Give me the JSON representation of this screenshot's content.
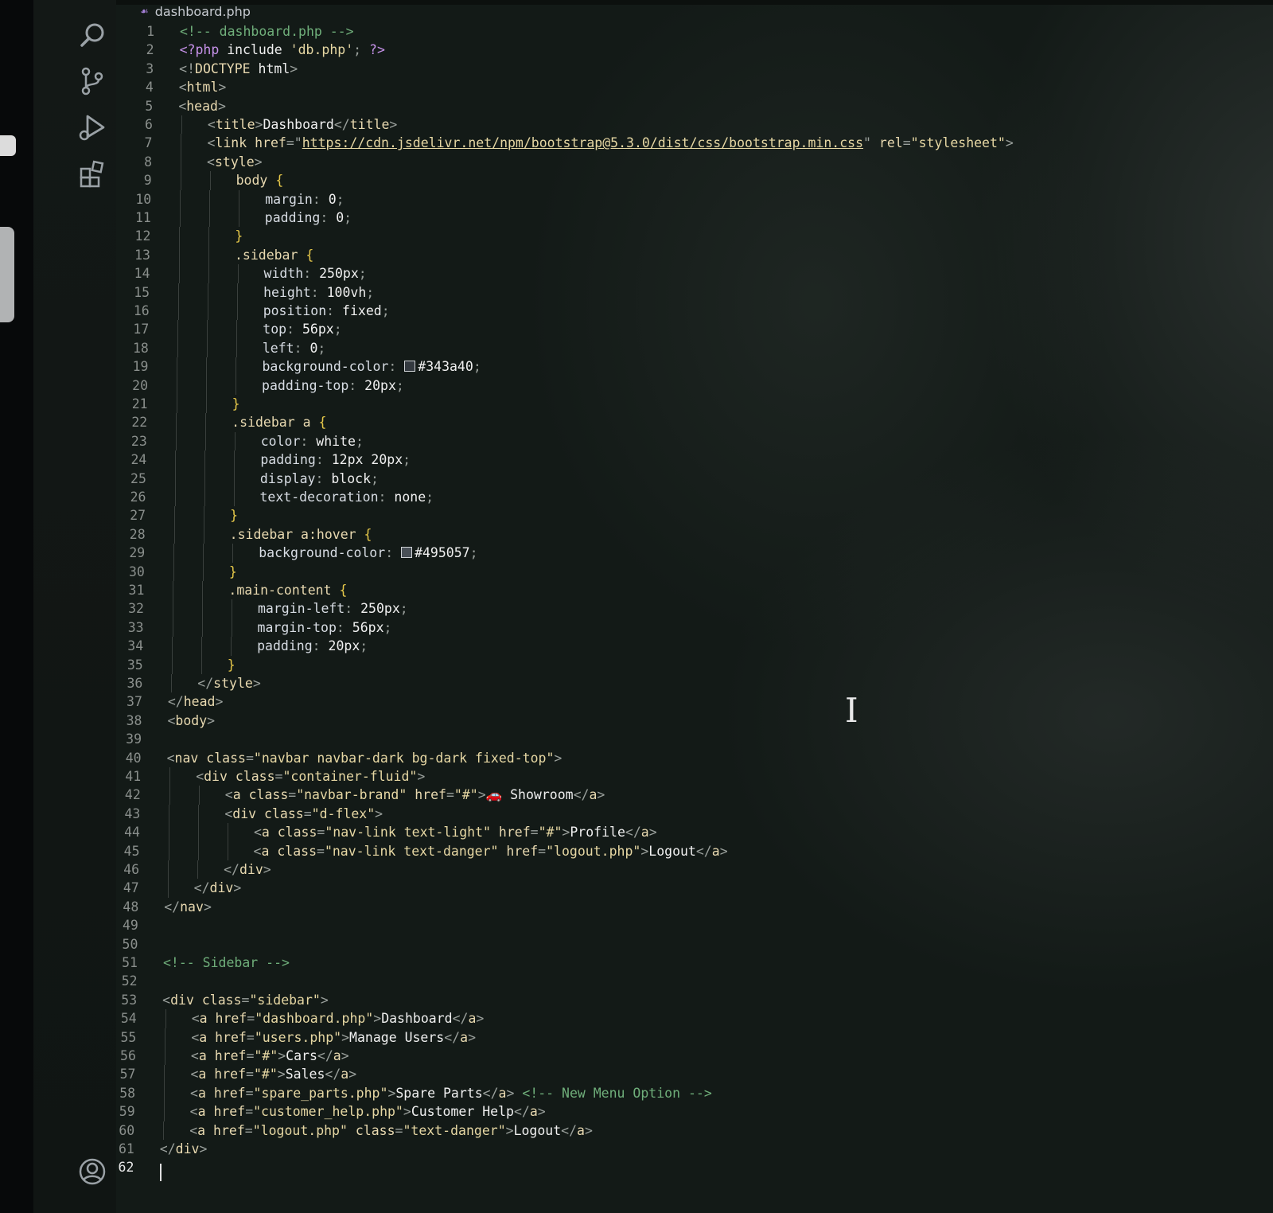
{
  "tab": {
    "filename": "dashboard.php"
  },
  "activity_bar": {
    "icons": [
      "search-icon",
      "source-control-icon",
      "run-debug-icon",
      "extensions-icon",
      "account-icon"
    ]
  },
  "editor": {
    "current_line": 62,
    "lines": [
      {
        "n": 1,
        "ind": 0,
        "html": "<span class='t-com'>&lt;!-- dashboard.php --&gt;</span>"
      },
      {
        "n": 2,
        "ind": 0,
        "html": "<span class='t-php'>&lt;?php</span> <span class='t-text'>include</span> <span class='t-str'>'db.php'</span><span class='t-punc'>;</span> <span class='t-php'>?&gt;</span>"
      },
      {
        "n": 3,
        "ind": 0,
        "html": "<span class='t-punc'>&lt;!</span><span class='t-tag'>DOCTYPE</span> <span class='t-text'>html</span><span class='t-punc'>&gt;</span>"
      },
      {
        "n": 4,
        "ind": 0,
        "html": "<span class='t-punc'>&lt;</span><span class='t-tag'>html</span><span class='t-punc'>&gt;</span>"
      },
      {
        "n": 5,
        "ind": 0,
        "html": "<span class='t-punc'>&lt;</span><span class='t-tag'>head</span><span class='t-punc'>&gt;</span>"
      },
      {
        "n": 6,
        "ind": 1,
        "html": "<span class='t-punc'>&lt;</span><span class='t-tag'>title</span><span class='t-punc'>&gt;</span><span class='t-text'>Dashboard</span><span class='t-punc'>&lt;/</span><span class='t-tag'>title</span><span class='t-punc'>&gt;</span>"
      },
      {
        "n": 7,
        "ind": 1,
        "html": "<span class='t-punc'>&lt;</span><span class='t-tag'>link</span> <span class='t-attr'>href</span><span class='t-punc'>=\"</span><span class='t-url'>https://cdn.jsdelivr.net/npm/bootstrap@5.3.0/dist/css/bootstrap.min.css</span><span class='t-punc'>\"</span> <span class='t-attr'>rel</span><span class='t-punc'>=</span><span class='t-str'>\"stylesheet\"</span><span class='t-punc'>&gt;</span>"
      },
      {
        "n": 8,
        "ind": 1,
        "html": "<span class='t-punc'>&lt;</span><span class='t-tag'>style</span><span class='t-punc'>&gt;</span>"
      },
      {
        "n": 9,
        "ind": 2,
        "html": "<span class='t-sel'>body</span> <span class='t-brace'>{</span>"
      },
      {
        "n": 10,
        "ind": 3,
        "html": "<span class='t-prop'>margin</span><span class='t-punc'>:</span> <span class='t-val'>0</span><span class='t-punc'>;</span>"
      },
      {
        "n": 11,
        "ind": 3,
        "html": "<span class='t-prop'>padding</span><span class='t-punc'>:</span> <span class='t-val'>0</span><span class='t-punc'>;</span>"
      },
      {
        "n": 12,
        "ind": 2,
        "html": "<span class='t-brace'>}</span>"
      },
      {
        "n": 13,
        "ind": 2,
        "html": "<span class='t-sel'>.sidebar</span> <span class='t-brace'>{</span>"
      },
      {
        "n": 14,
        "ind": 3,
        "html": "<span class='t-prop'>width</span><span class='t-punc'>:</span> <span class='t-val'>250px</span><span class='t-punc'>;</span>"
      },
      {
        "n": 15,
        "ind": 3,
        "html": "<span class='t-prop'>height</span><span class='t-punc'>:</span> <span class='t-val'>100vh</span><span class='t-punc'>;</span>"
      },
      {
        "n": 16,
        "ind": 3,
        "html": "<span class='t-prop'>position</span><span class='t-punc'>:</span> <span class='t-val'>fixed</span><span class='t-punc'>;</span>"
      },
      {
        "n": 17,
        "ind": 3,
        "html": "<span class='t-prop'>top</span><span class='t-punc'>:</span> <span class='t-val'>56px</span><span class='t-punc'>;</span>"
      },
      {
        "n": 18,
        "ind": 3,
        "html": "<span class='t-prop'>left</span><span class='t-punc'>:</span> <span class='t-val'>0</span><span class='t-punc'>;</span>"
      },
      {
        "n": 19,
        "ind": 3,
        "html": "<span class='t-prop'>background-color</span><span class='t-punc'>:</span> <span class='swatch' style='background:#343a40'></span><span class='t-val'>#343a40</span><span class='t-punc'>;</span>"
      },
      {
        "n": 20,
        "ind": 3,
        "html": "<span class='t-prop'>padding-top</span><span class='t-punc'>:</span> <span class='t-val'>20px</span><span class='t-punc'>;</span>"
      },
      {
        "n": 21,
        "ind": 2,
        "html": "<span class='t-brace'>}</span>"
      },
      {
        "n": 22,
        "ind": 2,
        "html": "<span class='t-sel'>.sidebar a</span> <span class='t-brace'>{</span>"
      },
      {
        "n": 23,
        "ind": 3,
        "html": "<span class='t-prop'>color</span><span class='t-punc'>:</span> <span class='t-val'>white</span><span class='t-punc'>;</span>"
      },
      {
        "n": 24,
        "ind": 3,
        "html": "<span class='t-prop'>padding</span><span class='t-punc'>:</span> <span class='t-val'>12px 20px</span><span class='t-punc'>;</span>"
      },
      {
        "n": 25,
        "ind": 3,
        "html": "<span class='t-prop'>display</span><span class='t-punc'>:</span> <span class='t-val'>block</span><span class='t-punc'>;</span>"
      },
      {
        "n": 26,
        "ind": 3,
        "html": "<span class='t-prop'>text-decoration</span><span class='t-punc'>:</span> <span class='t-val'>none</span><span class='t-punc'>;</span>"
      },
      {
        "n": 27,
        "ind": 2,
        "html": "<span class='t-brace'>}</span>"
      },
      {
        "n": 28,
        "ind": 2,
        "html": "<span class='t-sel'>.sidebar a:hover</span> <span class='t-brace'>{</span>"
      },
      {
        "n": 29,
        "ind": 3,
        "html": "<span class='t-prop'>background-color</span><span class='t-punc'>:</span> <span class='swatch' style='background:#495057'></span><span class='t-val'>#495057</span><span class='t-punc'>;</span>"
      },
      {
        "n": 30,
        "ind": 2,
        "html": "<span class='t-brace'>}</span>"
      },
      {
        "n": 31,
        "ind": 2,
        "html": "<span class='t-sel'>.main-content</span> <span class='t-brace'>{</span>"
      },
      {
        "n": 32,
        "ind": 3,
        "html": "<span class='t-prop'>margin-left</span><span class='t-punc'>:</span> <span class='t-val'>250px</span><span class='t-punc'>;</span>"
      },
      {
        "n": 33,
        "ind": 3,
        "html": "<span class='t-prop'>margin-top</span><span class='t-punc'>:</span> <span class='t-val'>56px</span><span class='t-punc'>;</span>"
      },
      {
        "n": 34,
        "ind": 3,
        "html": "<span class='t-prop'>padding</span><span class='t-punc'>:</span> <span class='t-val'>20px</span><span class='t-punc'>;</span>"
      },
      {
        "n": 35,
        "ind": 2,
        "html": "<span class='t-brace'>}</span>"
      },
      {
        "n": 36,
        "ind": 1,
        "html": "<span class='t-punc'>&lt;/</span><span class='t-tag'>style</span><span class='t-punc'>&gt;</span>"
      },
      {
        "n": 37,
        "ind": 0,
        "html": "<span class='t-punc'>&lt;/</span><span class='t-tag'>head</span><span class='t-punc'>&gt;</span>"
      },
      {
        "n": 38,
        "ind": 0,
        "html": "<span class='t-punc'>&lt;</span><span class='t-tag'>body</span><span class='t-punc'>&gt;</span>"
      },
      {
        "n": 39,
        "ind": 0,
        "html": ""
      },
      {
        "n": 40,
        "ind": 0,
        "html": "<span class='t-punc'>&lt;</span><span class='t-tag'>nav</span> <span class='t-attr'>class</span><span class='t-punc'>=</span><span class='t-str'>\"navbar navbar-dark bg-dark fixed-top\"</span><span class='t-punc'>&gt;</span>"
      },
      {
        "n": 41,
        "ind": 1,
        "html": "<span class='t-punc'>&lt;</span><span class='t-tag'>div</span> <span class='t-attr'>class</span><span class='t-punc'>=</span><span class='t-str'>\"container-fluid\"</span><span class='t-punc'>&gt;</span>"
      },
      {
        "n": 42,
        "ind": 2,
        "html": "<span class='t-punc'>&lt;</span><span class='t-tag'>a</span> <span class='t-attr'>class</span><span class='t-punc'>=</span><span class='t-str'>\"navbar-brand\"</span> <span class='t-attr'>href</span><span class='t-punc'>=</span><span class='t-str'>\"#\"</span><span class='t-punc'>&gt;</span><span style='color:#e0556b'>&#x1F697;</span> <span class='t-text'>Showroom</span><span class='t-punc'>&lt;/</span><span class='t-tag'>a</span><span class='t-punc'>&gt;</span>"
      },
      {
        "n": 43,
        "ind": 2,
        "html": "<span class='t-punc'>&lt;</span><span class='t-tag'>div</span> <span class='t-attr'>class</span><span class='t-punc'>=</span><span class='t-str'>\"d-flex\"</span><span class='t-punc'>&gt;</span>"
      },
      {
        "n": 44,
        "ind": 3,
        "html": "<span class='t-punc'>&lt;</span><span class='t-tag'>a</span> <span class='t-attr'>class</span><span class='t-punc'>=</span><span class='t-str'>\"nav-link text-light\"</span> <span class='t-attr'>href</span><span class='t-punc'>=</span><span class='t-str'>\"#\"</span><span class='t-punc'>&gt;</span><span class='t-text'>Profile</span><span class='t-punc'>&lt;/</span><span class='t-tag'>a</span><span class='t-punc'>&gt;</span>"
      },
      {
        "n": 45,
        "ind": 3,
        "html": "<span class='t-punc'>&lt;</span><span class='t-tag'>a</span> <span class='t-attr'>class</span><span class='t-punc'>=</span><span class='t-str'>\"nav-link text-danger\"</span> <span class='t-attr'>href</span><span class='t-punc'>=</span><span class='t-str'>\"logout.php\"</span><span class='t-punc'>&gt;</span><span class='t-text'>Logout</span><span class='t-punc'>&lt;/</span><span class='t-tag'>a</span><span class='t-punc'>&gt;</span>"
      },
      {
        "n": 46,
        "ind": 2,
        "html": "<span class='t-punc'>&lt;/</span><span class='t-tag'>div</span><span class='t-punc'>&gt;</span>"
      },
      {
        "n": 47,
        "ind": 1,
        "html": "<span class='t-punc'>&lt;/</span><span class='t-tag'>div</span><span class='t-punc'>&gt;</span>"
      },
      {
        "n": 48,
        "ind": 0,
        "html": "<span class='t-punc'>&lt;/</span><span class='t-tag'>nav</span><span class='t-punc'>&gt;</span>"
      },
      {
        "n": 49,
        "ind": 0,
        "html": ""
      },
      {
        "n": 50,
        "ind": 0,
        "html": ""
      },
      {
        "n": 51,
        "ind": 0,
        "html": "<span class='t-com'>&lt;!-- Sidebar --&gt;</span>"
      },
      {
        "n": 52,
        "ind": 0,
        "html": ""
      },
      {
        "n": 53,
        "ind": 0,
        "html": "<span class='t-punc'>&lt;</span><span class='t-tag'>div</span> <span class='t-attr'>class</span><span class='t-punc'>=</span><span class='t-str'>\"sidebar\"</span><span class='t-punc'>&gt;</span>"
      },
      {
        "n": 54,
        "ind": 1,
        "html": "<span class='t-punc'>&lt;</span><span class='t-tag'>a</span> <span class='t-attr'>href</span><span class='t-punc'>=</span><span class='t-str'>\"dashboard.php\"</span><span class='t-punc'>&gt;</span><span class='t-text'>Dashboard</span><span class='t-punc'>&lt;/</span><span class='t-tag'>a</span><span class='t-punc'>&gt;</span>"
      },
      {
        "n": 55,
        "ind": 1,
        "html": "<span class='t-punc'>&lt;</span><span class='t-tag'>a</span> <span class='t-attr'>href</span><span class='t-punc'>=</span><span class='t-str'>\"users.php\"</span><span class='t-punc'>&gt;</span><span class='t-text'>Manage Users</span><span class='t-punc'>&lt;/</span><span class='t-tag'>a</span><span class='t-punc'>&gt;</span>"
      },
      {
        "n": 56,
        "ind": 1,
        "html": "<span class='t-punc'>&lt;</span><span class='t-tag'>a</span> <span class='t-attr'>href</span><span class='t-punc'>=</span><span class='t-str'>\"#\"</span><span class='t-punc'>&gt;</span><span class='t-text'>Cars</span><span class='t-punc'>&lt;/</span><span class='t-tag'>a</span><span class='t-punc'>&gt;</span>"
      },
      {
        "n": 57,
        "ind": 1,
        "html": "<span class='t-punc'>&lt;</span><span class='t-tag'>a</span> <span class='t-attr'>href</span><span class='t-punc'>=</span><span class='t-str'>\"#\"</span><span class='t-punc'>&gt;</span><span class='t-text'>Sales</span><span class='t-punc'>&lt;/</span><span class='t-tag'>a</span><span class='t-punc'>&gt;</span>"
      },
      {
        "n": 58,
        "ind": 1,
        "html": "<span class='t-punc'>&lt;</span><span class='t-tag'>a</span> <span class='t-attr'>href</span><span class='t-punc'>=</span><span class='t-str'>\"spare_parts.php\"</span><span class='t-punc'>&gt;</span><span class='t-text'>Spare Parts</span><span class='t-punc'>&lt;/</span><span class='t-tag'>a</span><span class='t-punc'>&gt;</span> <span class='t-com'>&lt;!-- New Menu Option --&gt;</span>"
      },
      {
        "n": 59,
        "ind": 1,
        "html": "<span class='t-punc'>&lt;</span><span class='t-tag'>a</span> <span class='t-attr'>href</span><span class='t-punc'>=</span><span class='t-str'>\"customer_help.php\"</span><span class='t-punc'>&gt;</span><span class='t-text'>Customer Help</span><span class='t-punc'>&lt;/</span><span class='t-tag'>a</span><span class='t-punc'>&gt;</span>"
      },
      {
        "n": 60,
        "ind": 1,
        "html": "<span class='t-punc'>&lt;</span><span class='t-tag'>a</span> <span class='t-attr'>href</span><span class='t-punc'>=</span><span class='t-str'>\"logout.php\"</span> <span class='t-attr'>class</span><span class='t-punc'>=</span><span class='t-str'>\"text-danger\"</span><span class='t-punc'>&gt;</span><span class='t-text'>Logout</span><span class='t-punc'>&lt;/</span><span class='t-tag'>a</span><span class='t-punc'>&gt;</span>"
      },
      {
        "n": 61,
        "ind": 0,
        "html": "<span class='t-punc'>&lt;/</span><span class='t-tag'>div</span><span class='t-punc'>&gt;</span>"
      },
      {
        "n": 62,
        "ind": 0,
        "html": ""
      }
    ]
  }
}
